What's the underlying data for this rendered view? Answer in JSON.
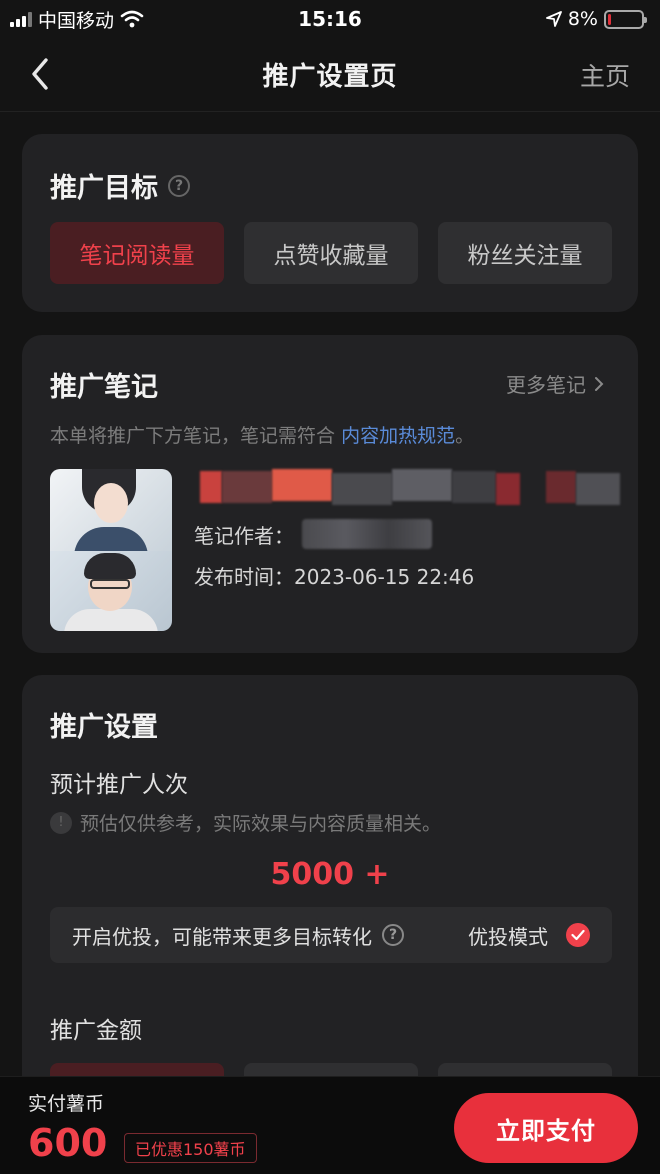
{
  "status_bar": {
    "carrier": "中国移动",
    "time": "15:16",
    "battery_percent": "8%",
    "battery_level": 0.08
  },
  "nav": {
    "title": "推广设置页",
    "home": "主页"
  },
  "goal": {
    "title": "推广目标",
    "options": [
      "笔记阅读量",
      "点赞收藏量",
      "粉丝关注量"
    ],
    "selected": "笔记阅读量"
  },
  "note": {
    "title": "推广笔记",
    "more": "更多笔记",
    "desc_prefix": "本单将推广下方笔记，笔记需符合",
    "desc_link": "内容加热规范",
    "desc_suffix": "。",
    "author_label": "笔记作者：",
    "publish_label": "发布时间：",
    "publish_time": "2023-06-15 22:46"
  },
  "settings": {
    "title": "推广设置",
    "estimate_label": "预计推广人次",
    "estimate_hint": "预估仅供参考，实际效果与内容质量相关。",
    "estimate_value": "5000 +",
    "boost_text": "开启优投，可能带来更多目标转化",
    "boost_mode": "优投模式",
    "boost_enabled": true,
    "amount_label": "推广金额"
  },
  "pay": {
    "label": "实付薯币",
    "amount": "600",
    "discount": "已优惠150薯币",
    "button": "立即支付"
  },
  "colors": {
    "accent": "#f0414b",
    "link": "#5a8bd8",
    "card": "#222224",
    "background": "#141414"
  }
}
